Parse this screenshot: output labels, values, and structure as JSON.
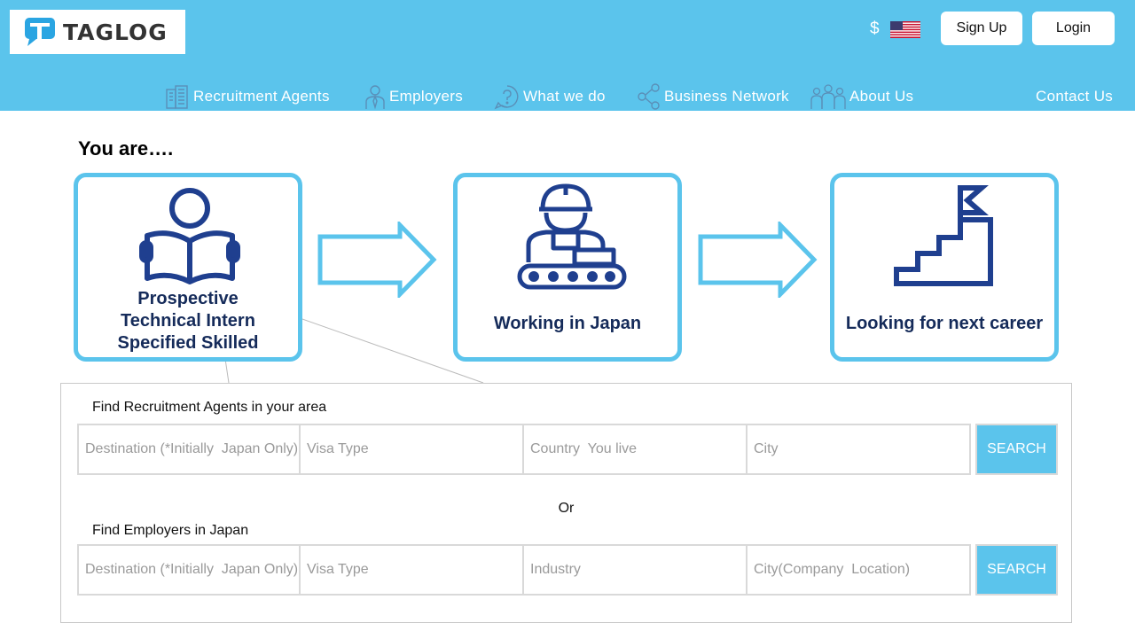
{
  "brand": {
    "name": "TAGLOG"
  },
  "header": {
    "currency": "$",
    "flag_icon": "us-flag-icon",
    "signup_label": "Sign Up",
    "login_label": "Login",
    "colors": {
      "primary": "#5bc4ec",
      "navy": "#1f3f8f"
    }
  },
  "nav": {
    "items": [
      {
        "label": "Recruitment  Agents",
        "icon": "building-icon"
      },
      {
        "label": "Employers",
        "icon": "businessman-icon"
      },
      {
        "label": "What we do",
        "icon": "question-bubble-icon"
      },
      {
        "label": "Business  Network",
        "icon": "share-network-icon"
      },
      {
        "label": "About  Us",
        "icon": "people-group-icon"
      },
      {
        "label": "Contact  Us"
      }
    ]
  },
  "main": {
    "heading": "You are….",
    "cards": [
      {
        "icon": "reading-person-icon",
        "lines": [
          "Prospective",
          "Technical Intern",
          "Specified Skilled"
        ]
      },
      {
        "icon": "factory-worker-icon",
        "lines": [
          "Working in Japan"
        ]
      },
      {
        "icon": "stairs-flag-icon",
        "lines": [
          "Looking for next career"
        ]
      }
    ]
  },
  "search": {
    "agents": {
      "label": "Find  Recruitment  Agents  in your area",
      "placeholders": [
        "Destination (*Initially  Japan Only)",
        "Visa Type",
        "Country  You live",
        "City"
      ],
      "button": "SEARCH"
    },
    "or_label": "Or",
    "employers": {
      "label": "Find  Employers  in  Japan",
      "placeholders": [
        "Destination (*Initially  Japan Only)",
        "Visa Type",
        "Industry",
        "City(Company  Location)"
      ],
      "button": "SEARCH"
    }
  }
}
